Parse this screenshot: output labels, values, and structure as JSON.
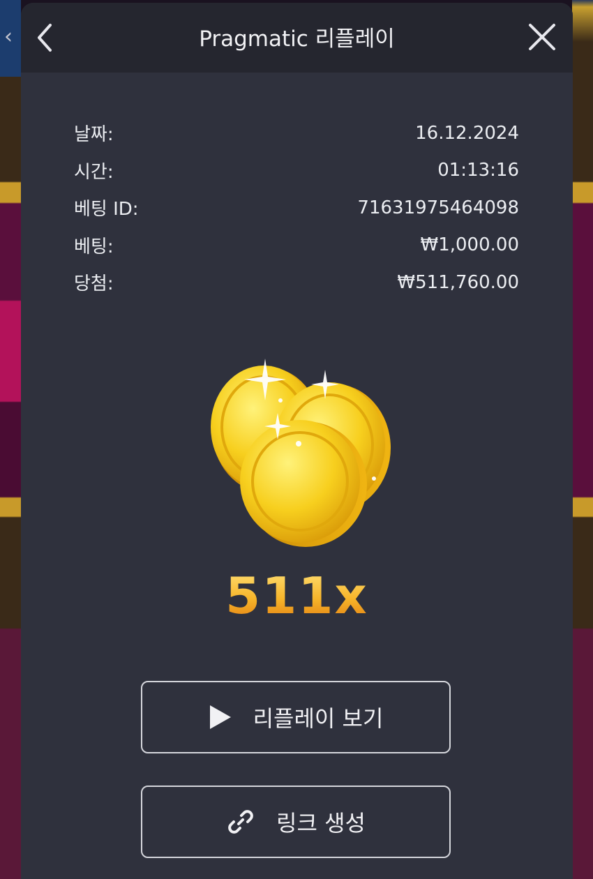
{
  "header": {
    "title": "Pragmatic 리플레이"
  },
  "info": [
    {
      "label": "날짜:",
      "value": "16.12.2024"
    },
    {
      "label": "시간:",
      "value": "01:13:16"
    },
    {
      "label": "베팅 ID:",
      "value": "71631975464098"
    },
    {
      "label": "베팅:",
      "value": "₩1,000.00"
    },
    {
      "label": "당첨:",
      "value": "₩511,760.00"
    }
  ],
  "win": {
    "multiplier": "511x"
  },
  "buttons": {
    "replay_label": "리플레이 보기",
    "link_label": "링크 생성"
  },
  "icons": {
    "back": "chevron-left-icon",
    "close": "close-icon",
    "play": "play-icon",
    "link": "link-icon",
    "coins": "gold-coins-icon"
  },
  "colors": {
    "panel": "#2f313d",
    "header": "#25262f",
    "multiplier_gold": "#f2a51f"
  }
}
